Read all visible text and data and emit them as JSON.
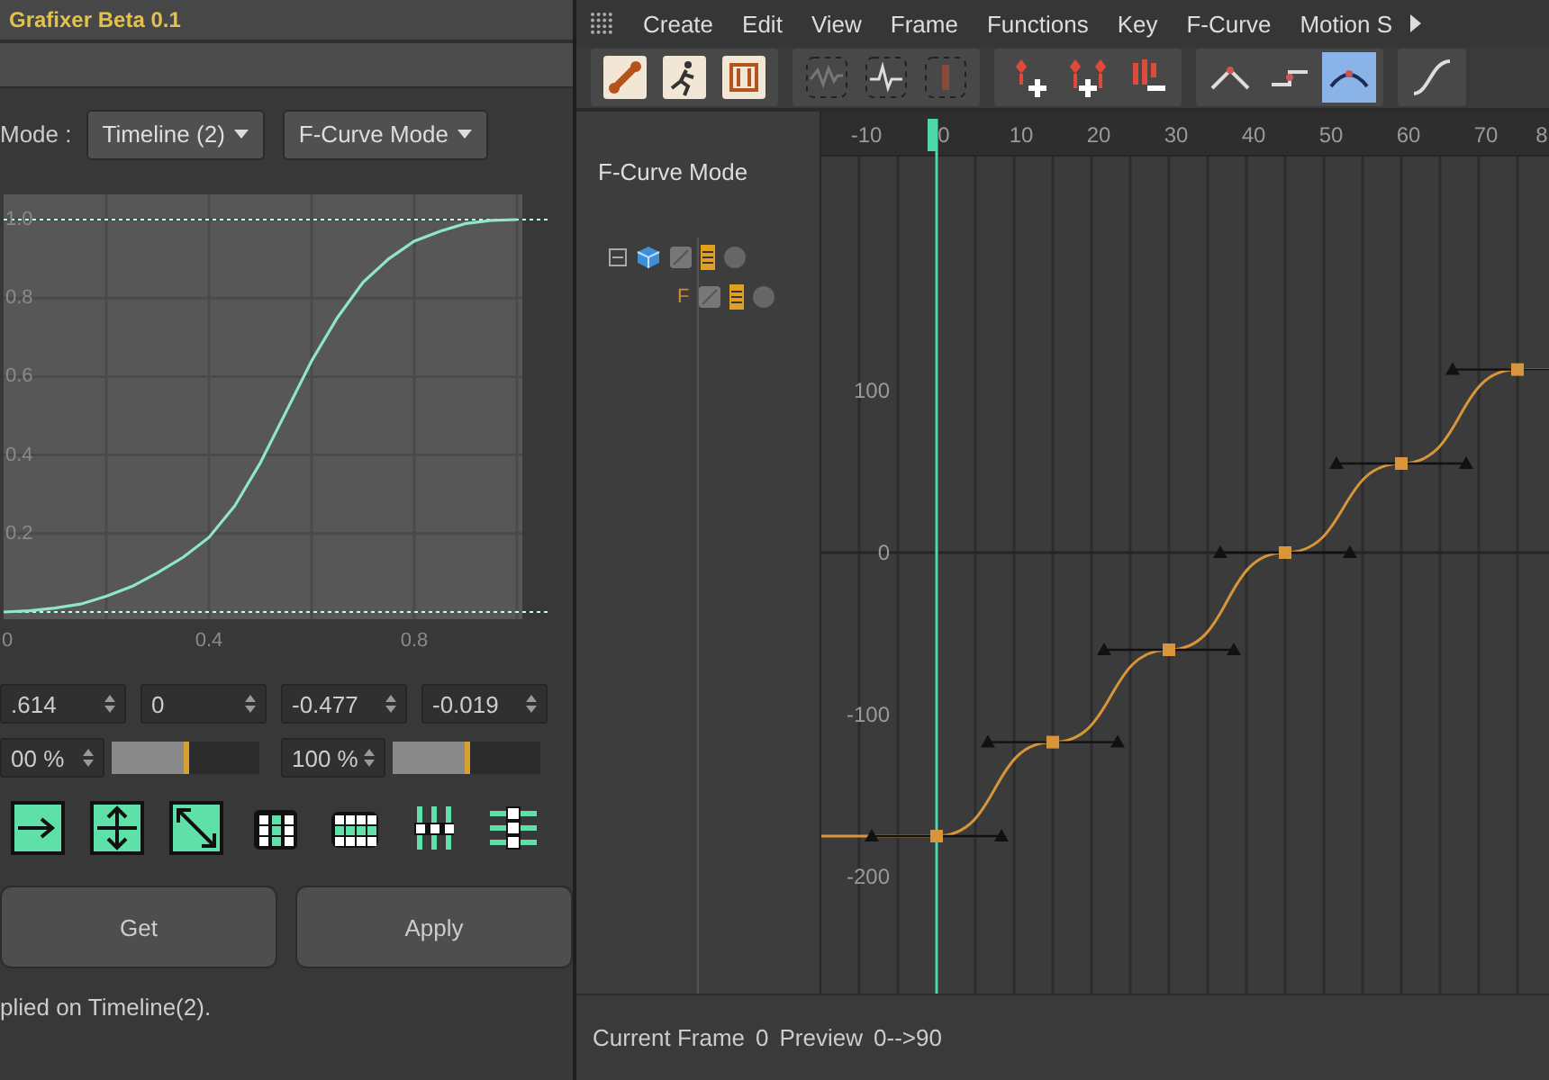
{
  "left_panel": {
    "title": "Grafixer Beta 0.1",
    "mode_label": "Mode :",
    "dropdowns": [
      {
        "value": "Timeline (2)"
      },
      {
        "value": "F-Curve Mode"
      }
    ],
    "preview": {
      "chart_data": {
        "type": "line",
        "x": [
          0,
          0.05,
          0.1,
          0.15,
          0.2,
          0.25,
          0.3,
          0.35,
          0.4,
          0.45,
          0.5,
          0.55,
          0.6,
          0.65,
          0.7,
          0.75,
          0.8,
          0.85,
          0.9,
          0.95,
          1
        ],
        "series": [
          {
            "color": "#8fe6c8",
            "values": [
              0,
              0.003,
              0.01,
              0.02,
              0.04,
              0.065,
              0.1,
              0.14,
              0.19,
              0.27,
              0.38,
              0.51,
              0.64,
              0.75,
              0.84,
              0.9,
              0.945,
              0.97,
              0.99,
              0.998,
              1
            ]
          }
        ],
        "xlim": [
          0,
          1
        ],
        "ylim": [
          0,
          1
        ],
        "grid": true,
        "ref_lines": [
          {
            "axis": "y",
            "value": 0
          },
          {
            "axis": "y",
            "value": 1
          }
        ],
        "xticks": [
          0,
          0.4,
          0.8
        ],
        "yticks": [
          {
            "value": 0.2,
            "label": "0.2"
          },
          {
            "value": 0.4,
            "label": "0.4"
          },
          {
            "value": 0.6,
            "label": "0.6"
          },
          {
            "value": 0.8,
            "label": "0.8"
          },
          {
            "value": 1,
            "label": "1.0"
          }
        ]
      }
    },
    "number_fields": [
      ".614",
      "0",
      "-0.477",
      "-0.019"
    ],
    "sliders": [
      {
        "reading": "00 %",
        "level": 0.53
      },
      {
        "reading": "100 %",
        "level": 0.53
      }
    ],
    "tool_icons": [
      {
        "kind": "arrow-right"
      },
      {
        "kind": "arrow-vertical"
      },
      {
        "kind": "arrow-diagonal"
      },
      {
        "kind": "dots-column"
      },
      {
        "kind": "dots-row"
      },
      {
        "kind": "dots-vbars"
      },
      {
        "kind": "dots-hbars"
      }
    ],
    "buttons": [
      "Get",
      "Apply"
    ],
    "status": "plied on Timeline(2)."
  },
  "timeline": {
    "menu": [
      "Create",
      "Edit",
      "View",
      "Frame",
      "Functions",
      "Key",
      "F-Curve",
      "Motion S"
    ],
    "toolbar": [
      {
        "buttons": [
          {
            "kind": "bone",
            "selected": false
          },
          {
            "kind": "runner",
            "selected": false
          },
          {
            "kind": "film",
            "selected": false
          }
        ]
      },
      {
        "buttons": [
          {
            "kind": "wave",
            "selected": false
          },
          {
            "kind": "pulse",
            "selected": false
          },
          {
            "kind": "bar",
            "selected": false
          }
        ]
      },
      {
        "buttons": [
          {
            "kind": "key-add",
            "selected": false
          },
          {
            "kind": "keys-add",
            "selected": false
          },
          {
            "kind": "keys-remove",
            "selected": false
          }
        ]
      },
      {
        "buttons": [
          {
            "kind": "peak",
            "selected": false
          },
          {
            "kind": "step",
            "selected": false
          },
          {
            "kind": "arc",
            "selected": true
          }
        ]
      },
      {
        "buttons": [
          {
            "kind": "ramp",
            "selected": false
          }
        ]
      }
    ],
    "mode_title": "F-Curve Mode",
    "tree": [
      {
        "expanded": true,
        "children": [
          {
            "label": "F"
          }
        ]
      }
    ],
    "graph": {
      "ruler_labels": [
        "-10",
        "0",
        "10",
        "20",
        "30",
        "40",
        "50",
        "60",
        "70",
        "8"
      ],
      "value_labels": [
        "100",
        "0",
        "-100",
        "-200"
      ]
    },
    "status_bar": {
      "current_frame_label": "Current Frame",
      "current_frame": "0",
      "preview_label": "Preview",
      "preview_range": "0-->90"
    }
  }
}
